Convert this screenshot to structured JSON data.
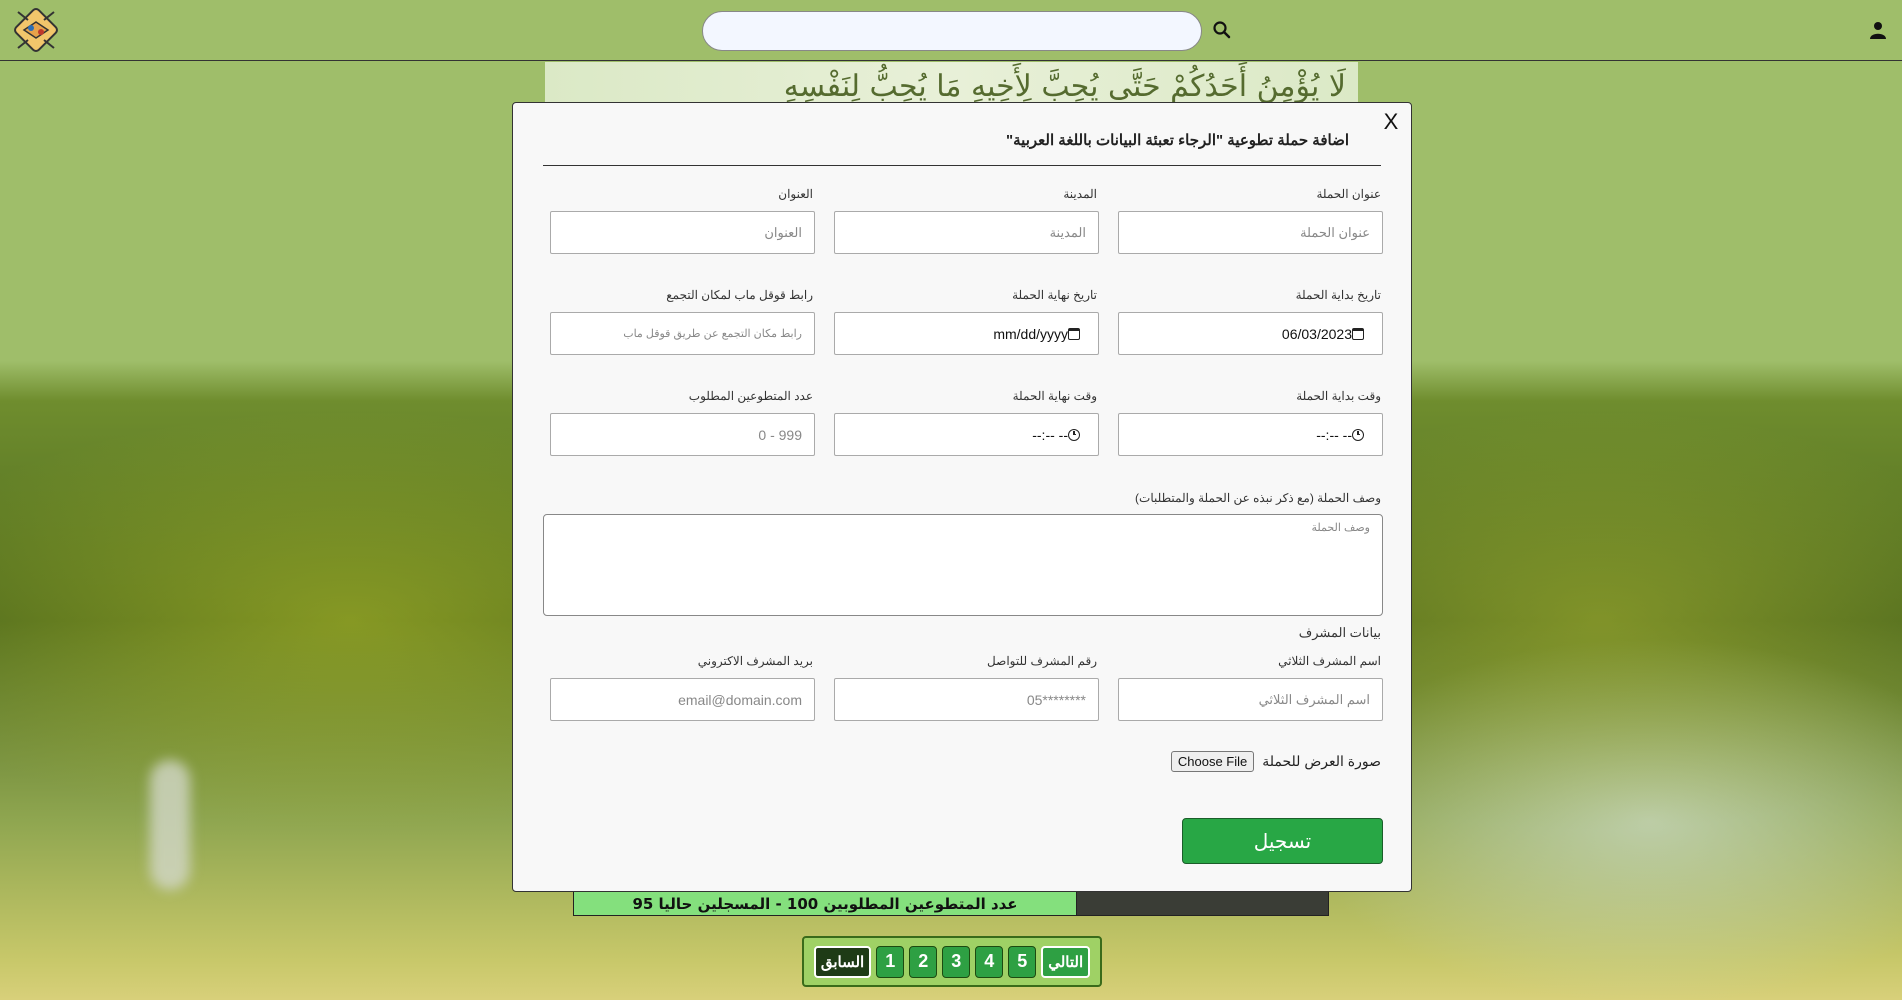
{
  "header": {
    "search_placeholder": "",
    "logo_icon": "handshake-logo-icon",
    "search_icon": "search-icon",
    "user_icon": "user-icon"
  },
  "background": {
    "banner_text": "لَا يُؤْمِنُ أَحَدُكُمْ حَتَّى يُحِبَّ لِأَخِيهِ مَا يُحِبُّ لِنَفْسِهِ",
    "card_text": "عدد المتطوعين المطلوبين 100 - المسجلين حاليا 95"
  },
  "pagination": {
    "prev_label": "السابق",
    "pages": [
      "1",
      "2",
      "3",
      "4",
      "5"
    ],
    "next_label": "التالي"
  },
  "modal": {
    "close_label": "X",
    "title": "اضافة حملة تطوعية \"الرجاء تعبئة البيانات باللغة العربية\"",
    "fields": {
      "campaign_title": {
        "label": "عنوان الحملة",
        "placeholder": "عنوان الحملة"
      },
      "city": {
        "label": "المدينة",
        "placeholder": "المدينة"
      },
      "address": {
        "label": "العنوان",
        "placeholder": "العنوان"
      },
      "start_date": {
        "label": "تاريخ بداية الحملة",
        "value": "06/03/2023"
      },
      "end_date": {
        "label": "تاريخ نهاية الحملة",
        "value": "mm/dd/yyyy"
      },
      "map_link": {
        "label": "رابط قوقل ماب لمكان التجمع",
        "placeholder": "رابط مكان التجمع عن طريق قوقل ماب"
      },
      "start_time": {
        "label": "وقت بداية الحملة",
        "value": "--:-- --"
      },
      "end_time": {
        "label": "وقت نهاية الحملة",
        "value": "--:-- --"
      },
      "volunteers_needed": {
        "label": "عدد المتطوعين المطلوب",
        "placeholder": "0 - 999"
      },
      "description": {
        "label": "وصف الحملة (مع ذكر نبذه عن الحملة والمتطلبات)",
        "placeholder": "وصف الحملة"
      },
      "supervisor_heading": "بيانات المشرف",
      "supervisor_name": {
        "label": "اسم المشرف الثلاثي",
        "placeholder": "اسم المشرف الثلاثي"
      },
      "supervisor_phone": {
        "label": "رقم المشرف للتواصل",
        "placeholder": "05********"
      },
      "supervisor_email": {
        "label": "بريد المشرف الاكتروني",
        "placeholder": "email@domain.com"
      },
      "image": {
        "label": "صورة العرض للحملة",
        "button": "Choose File"
      }
    },
    "submit_label": "تسجيل"
  }
}
